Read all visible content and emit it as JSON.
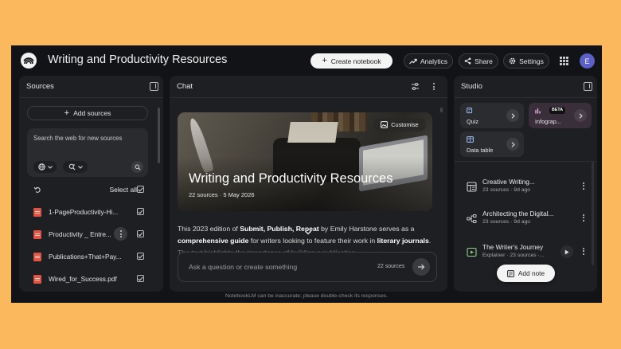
{
  "app": {
    "title": "Writing and Productivity Resources",
    "avatar_letter": "E"
  },
  "topbar": {
    "create_notebook": "Create notebook",
    "analytics": "Analytics",
    "share": "Share",
    "settings": "Settings"
  },
  "sources": {
    "title": "Sources",
    "add_sources": "Add sources",
    "search_placeholder": "Search the web for new sources",
    "select_all": "Select all",
    "items": [
      {
        "label": "1-PageProductivity-Hi...",
        "checked": true
      },
      {
        "label": "Productivity _ Entre...",
        "checked": true
      },
      {
        "label": "Publications+That+Pay...",
        "checked": true
      },
      {
        "label": "Wired_for_Success.pdf",
        "checked": true
      }
    ]
  },
  "chat": {
    "title": "Chat",
    "hero": {
      "title": "Writing and Productivity Resources",
      "meta": "22 sources · 5 May 2026",
      "customise": "Customise"
    },
    "summary": {
      "t1": "This 2023 edition of ",
      "b1": "Submit, Publish, Repeat",
      "t2": " by Emily Harstone serves as a ",
      "b2": "comprehensive guide",
      "t3": " for writers looking to feature their work in ",
      "b3": "literary journals",
      "t4": ". The text highlights the importance of building a publication"
    },
    "input_placeholder": "Ask a question or create something",
    "source_count": "22 sources"
  },
  "studio": {
    "title": "Studio",
    "tiles": [
      {
        "label": "Quiz"
      },
      {
        "label": "Infograp...",
        "badge": "BETA"
      },
      {
        "label": "Data table"
      }
    ],
    "notes": [
      {
        "title": "Creative Writing...",
        "meta": "23 sources · 9d ago",
        "icon": "report-icon"
      },
      {
        "title": "Architecting the Digital...",
        "meta": "23 sources · 9d ago",
        "icon": "mindmap-icon"
      },
      {
        "title": "The Writer's Journey",
        "meta": "Explainer · 23 sources ·...",
        "icon": "video-overview-icon"
      }
    ],
    "add_note": "Add note"
  },
  "footer": "NotebookLM can be inaccurate; please double-check its responses.",
  "colors": {
    "background": "#fbb85c",
    "window": "#121316",
    "panel": "#1e1f22",
    "pdf_red": "#e25545",
    "avatar": "#5b5fc7"
  }
}
